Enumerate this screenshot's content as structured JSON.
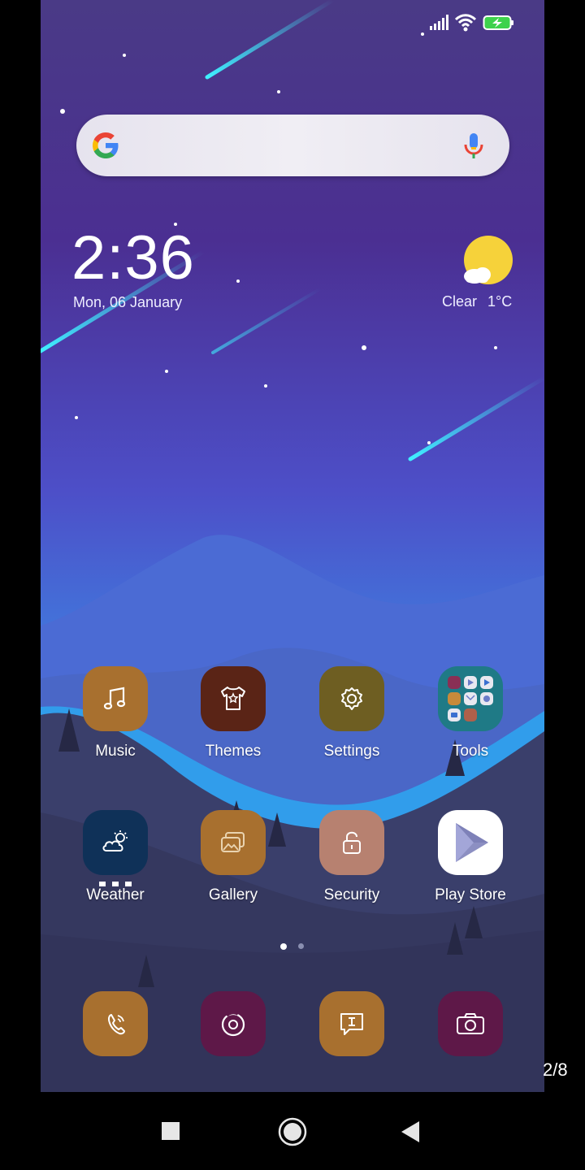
{
  "status_bar": {
    "icons": [
      "signal-icon",
      "wifi-icon",
      "battery-charging-icon"
    ]
  },
  "search_bar": {
    "icons": [
      "google-logo-icon",
      "microphone-icon"
    ]
  },
  "clock_widget": {
    "time": "2:36",
    "date": "Mon, 06 January"
  },
  "weather_widget": {
    "condition": "Clear",
    "temperature": "1°C",
    "icon": "sun-cloud-icon"
  },
  "apps_row1": [
    {
      "label": "Music",
      "icon": "music-note-icon",
      "color": "#a8702f"
    },
    {
      "label": "Themes",
      "icon": "tshirt-icon",
      "color": "#5a2416"
    },
    {
      "label": "Settings",
      "icon": "gear-icon",
      "color": "#6e5e22"
    },
    {
      "label": "Tools",
      "icon": "folder-grid-icon",
      "color": "#1f7a86"
    }
  ],
  "apps_row2": [
    {
      "label": "Weather",
      "icon": "weather-cloud-sun-icon",
      "color": "#0f3158"
    },
    {
      "label": "Gallery",
      "icon": "gallery-icon",
      "color": "#a8702f"
    },
    {
      "label": "Security",
      "icon": "lock-icon",
      "color": "#b78170"
    },
    {
      "label": "Play Store",
      "icon": "play-store-icon",
      "color": "#ffffff"
    }
  ],
  "page_indicator": {
    "pages": 2,
    "active": 1
  },
  "dock": [
    {
      "icon": "phone-icon",
      "color": "#a8702f"
    },
    {
      "icon": "browser-icon",
      "color": "#5e1848"
    },
    {
      "icon": "messages-icon",
      "color": "#a8702f"
    },
    {
      "icon": "camera-icon",
      "color": "#5e1848"
    }
  ],
  "nav_bar": {
    "buttons": [
      "recents-button",
      "home-button",
      "back-button"
    ]
  },
  "overlay": {
    "page_counter": "2/8"
  }
}
